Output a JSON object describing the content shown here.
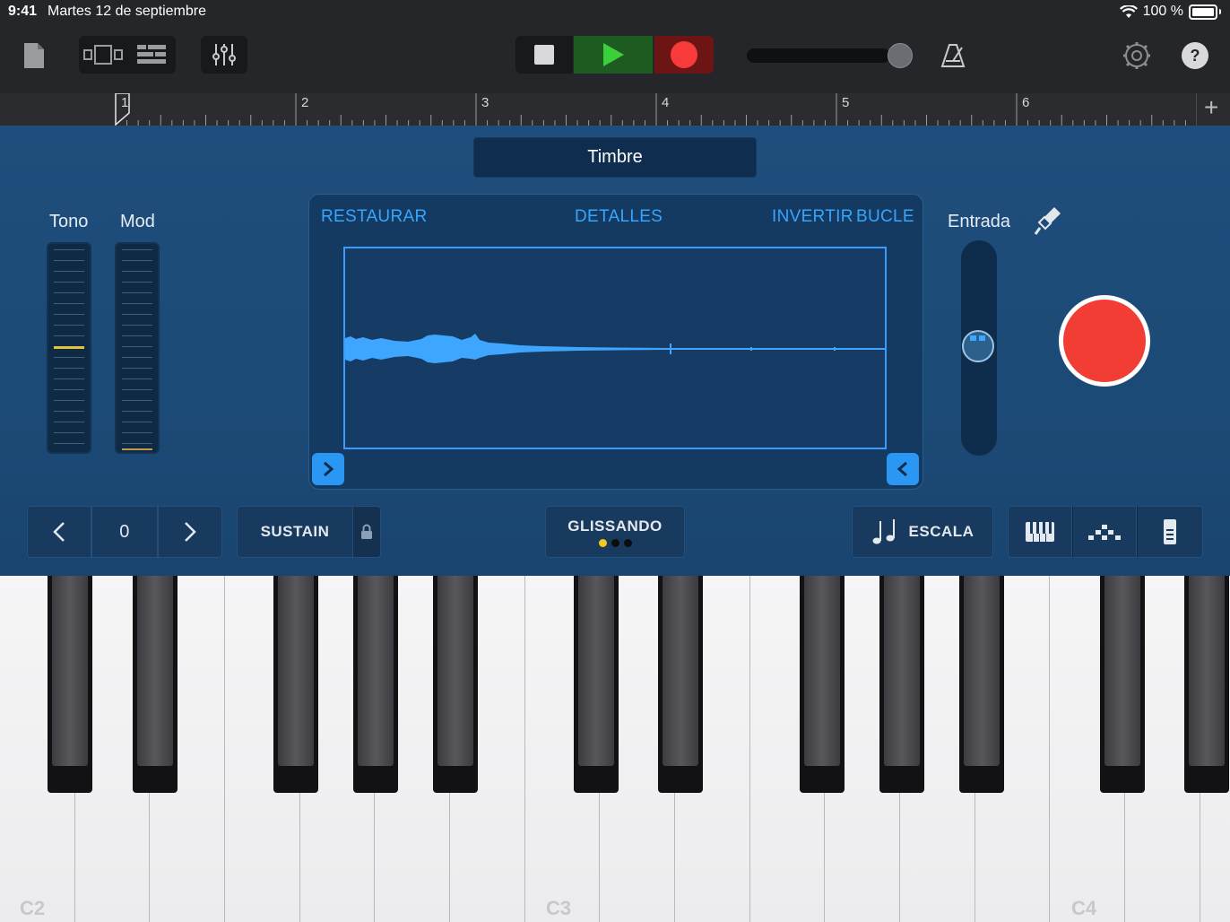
{
  "status": {
    "time": "9:41",
    "date": "Martes 12 de septiembre",
    "battery": "100 %"
  },
  "ruler": {
    "bars": [
      "1",
      "2",
      "3",
      "4",
      "5",
      "6"
    ],
    "add": "+"
  },
  "panel": {
    "title": "Timbre",
    "tono_label": "Tono",
    "mod_label": "Mod",
    "entrada_label": "Entrada",
    "wave_actions": {
      "restore": "RESTAURAR",
      "details": "DETALLES",
      "reverse": "INVERTIR",
      "loop": "BUCLE"
    }
  },
  "controls": {
    "octave_value": "0",
    "sustain": "SUSTAIN",
    "glissando": "GLISSANDO",
    "scale": "ESCALA"
  },
  "keyboard": {
    "labels": [
      "C2",
      "C3",
      "C4"
    ]
  },
  "colors": {
    "accent": "#35a6ff",
    "record": "#f23d35",
    "play": "#3ccf3c",
    "panel": "#1f4e7c"
  }
}
